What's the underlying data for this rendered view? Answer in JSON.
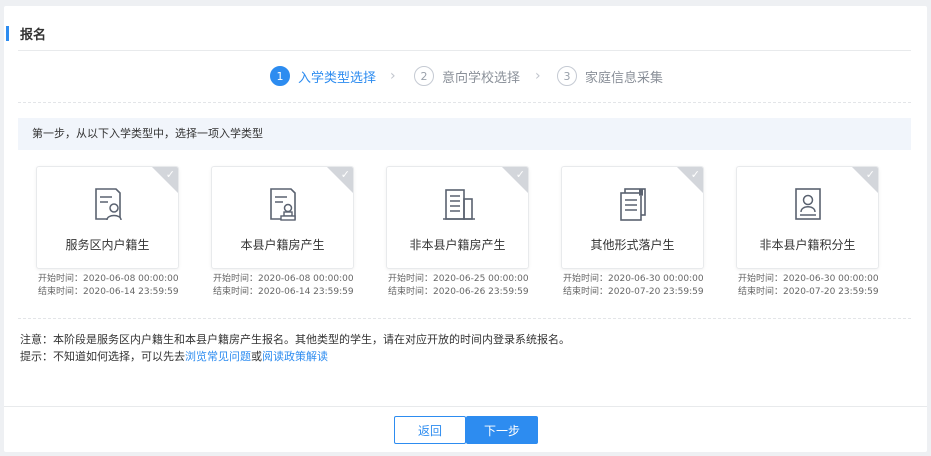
{
  "page": {
    "title": "报名"
  },
  "steps": [
    {
      "num": "1",
      "label": "入学类型选择",
      "active": true
    },
    {
      "num": "2",
      "label": "意向学校选择",
      "active": false
    },
    {
      "num": "3",
      "label": "家庭信息采集",
      "active": false
    }
  ],
  "step_arrow": "›",
  "instruction": "第一步，从以下入学类型中，选择一项入学类型",
  "cards": [
    {
      "name": "服务区内户籍生",
      "icon": "document-person-icon",
      "start_label": "开始时间：",
      "start": "2020-06-08  00:00:00",
      "end_label": "结束时间：",
      "end": "2020-06-14  23:59:59"
    },
    {
      "name": "本县户籍房产生",
      "icon": "document-stamp-icon",
      "start_label": "开始时间：",
      "start": "2020-06-08  00:00:00",
      "end_label": "结束时间：",
      "end": "2020-06-14  23:59:59"
    },
    {
      "name": "非本县户籍房产生",
      "icon": "building-icon",
      "start_label": "开始时间：",
      "start": "2020-06-25  00:00:00",
      "end_label": "结束时间：",
      "end": "2020-06-26  23:59:59"
    },
    {
      "name": "其他形式落户生",
      "icon": "stacked-documents-icon",
      "start_label": "开始时间：",
      "start": "2020-06-30  00:00:00",
      "end_label": "结束时间：",
      "end": "2020-07-20  23:59:59"
    },
    {
      "name": "非本县户籍积分生",
      "icon": "id-card-person-icon",
      "start_label": "开始时间：",
      "start": "2020-06-30  00:00:00",
      "end_label": "结束时间：",
      "end": "2020-07-20  23:59:59"
    }
  ],
  "notes": {
    "note": "注意：本阶段是服务区内户籍生和本县户籍房产生报名。其他类型的学生，请在对应开放的时间内登录系统报名。",
    "tip_prefix": "提示：不知道如何选择，可以先去",
    "tip_link1": "浏览常见问题",
    "tip_or": "或",
    "tip_link2": "阅读政策解读"
  },
  "buttons": {
    "back": "返回",
    "next": "下一步"
  },
  "colors": {
    "accent": "#2d8cf0",
    "corner": "#d3d6db",
    "hint_bg": "#f1f5fb"
  }
}
